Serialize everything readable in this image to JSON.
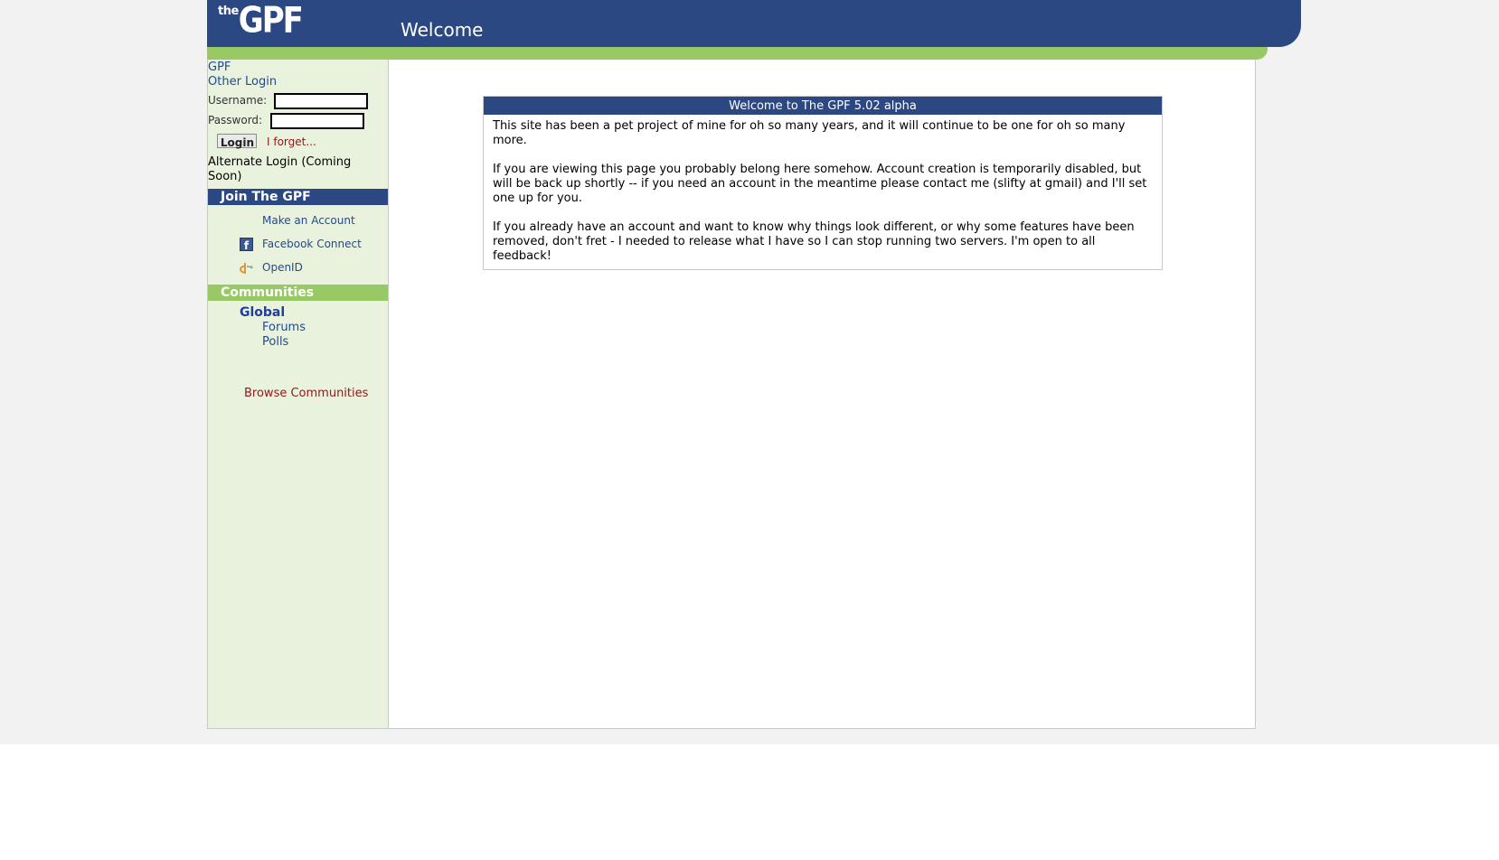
{
  "header": {
    "logo_the": "the",
    "logo_gpf": "GPF",
    "title": "Welcome"
  },
  "sidebar": {
    "nav": {
      "gpf_link": "GPF",
      "other_login": "Other Login"
    },
    "login": {
      "username_label": "Username:",
      "password_label": "Password:",
      "username_value": "",
      "password_value": "",
      "button": "Login",
      "forget": "I forget...",
      "alternate": "Alternate Login (Coming Soon)"
    },
    "join": {
      "heading": "Join The GPF",
      "items": [
        "Make an Account",
        "Facebook Connect",
        "OpenID"
      ],
      "icons": [
        "",
        "facebook-icon",
        "openid-icon"
      ]
    },
    "communities": {
      "heading": "Communities",
      "global": "Global",
      "sub": [
        "Forums",
        "Polls"
      ],
      "browse": "Browse Communities"
    }
  },
  "main": {
    "panel_title": "Welcome to The GPF 5.02 alpha",
    "paragraphs": [
      "This site has been a pet project of mine for oh so many years, and it will continue to be one for oh so many more.",
      "If you are viewing this page you probably belong here somehow. Account creation is temporarily disabled, but will be back up shortly -- if you need an account in the meantime please contact me (slifty at gmail) and I'll set one up for you.",
      "If you already have an account and want to know why things look different, or why some features have been removed, don't fret - I needed to release what I have so I can stop running two servers. I'm open to all feedback!"
    ]
  },
  "colors": {
    "header_blue": "#2b4883",
    "accent_green": "#98c965",
    "sidebar_bg": "#e9f2dc",
    "link_blue": "#1f4a96",
    "link_red": "#8b1a1a"
  }
}
